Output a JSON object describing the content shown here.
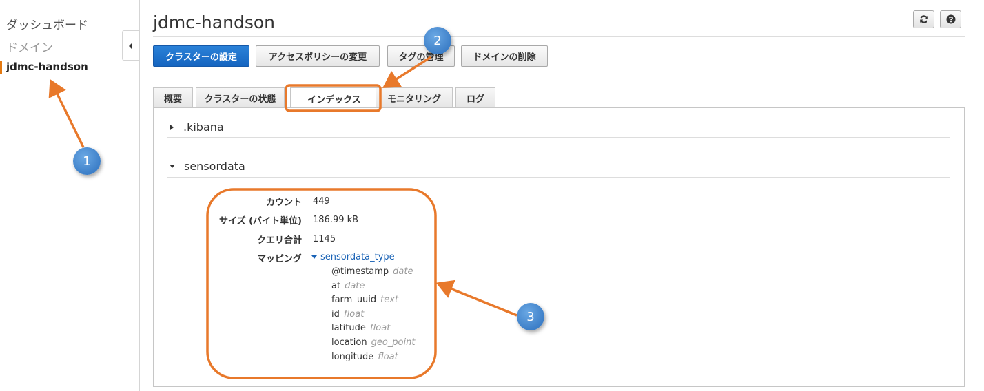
{
  "sidebar": {
    "items": [
      {
        "label": "ダッシュボード"
      },
      {
        "label": "ドメイン"
      },
      {
        "label": "jdmc-handson"
      }
    ]
  },
  "header": {
    "title": "jdmc-handson",
    "refresh_icon": "refresh-icon",
    "help_icon": "help-icon"
  },
  "toolbar": {
    "configure_label": "クラスターの設定",
    "access_policy_label": "アクセスポリシーの変更",
    "tags_label": "タグの管理",
    "delete_label": "ドメインの削除"
  },
  "tabs": [
    {
      "label": "概要"
    },
    {
      "label": "クラスターの状態"
    },
    {
      "label": "インデックス"
    },
    {
      "label": "モニタリング"
    },
    {
      "label": "ログ"
    }
  ],
  "indices": [
    {
      "name": ".kibana",
      "expanded": false
    },
    {
      "name": "sensordata",
      "expanded": true
    }
  ],
  "sensordata": {
    "count_label": "カウント",
    "count_value": "449",
    "size_label": "サイズ (バイト単位)",
    "size_value": "186.99 kB",
    "query_label": "クエリ合計",
    "query_value": "1145",
    "mapping_label": "マッピング",
    "mapping_type": "sensordata_type",
    "fields": [
      {
        "name": "@timestamp",
        "type": "date"
      },
      {
        "name": "at",
        "type": "date"
      },
      {
        "name": "farm_uuid",
        "type": "text"
      },
      {
        "name": "id",
        "type": "float"
      },
      {
        "name": "latitude",
        "type": "float"
      },
      {
        "name": "location",
        "type": "geo_point"
      },
      {
        "name": "longitude",
        "type": "float"
      }
    ]
  },
  "annotations": {
    "badge1": "1",
    "badge2": "2",
    "badge3": "3",
    "color_highlight": "#e8792b",
    "color_badge": "#3d7fc8"
  }
}
